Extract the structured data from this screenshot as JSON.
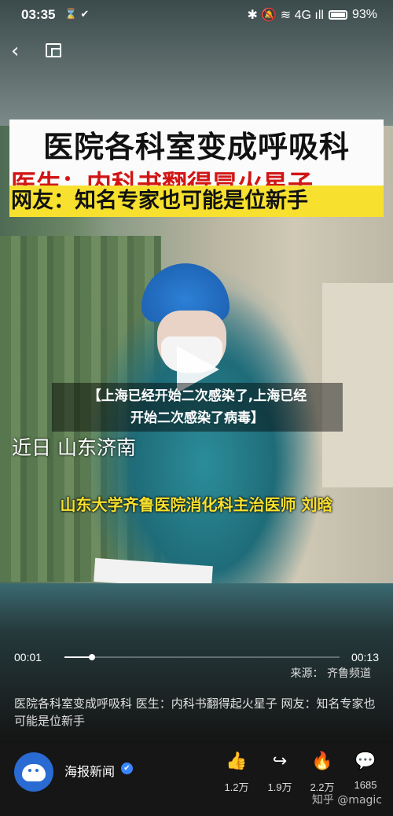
{
  "status_bar": {
    "time": "03:35",
    "left_icons": "⌛ ✔",
    "right_icons": "✱ 🔕 ≋ 4G ıll",
    "battery": "93%"
  },
  "nav": {
    "back_icon": "‹"
  },
  "video": {
    "banner_line1": "医院各科室变成呼吸科",
    "banner_line2": "医生：内科书翻得冒火星子",
    "banner_line3": "网友：知名专家也可能是位新手",
    "headline_line1": "【上海已经开始二次感染了,上海已经",
    "headline_line2": "开始二次感染了病毒】",
    "location": "近日  山东济南",
    "caption": "山东大学齐鲁医院消化科主治医师  刘晗",
    "current_time": "00:01",
    "duration": "00:13",
    "progress": 0.1,
    "source": "来源：  齐鲁频道"
  },
  "description": "医院各科室变成呼吸科 医生：内科书翻得起火星子 网友：知名专家也可能是位新手",
  "author": {
    "name": "海报新闻",
    "verified_icon": "✔"
  },
  "actions": [
    {
      "icon": "👍",
      "count": "1.2万"
    },
    {
      "icon": "↪",
      "count": "1.9万"
    },
    {
      "icon": "🔥",
      "count": "2.2万"
    },
    {
      "icon": "💬",
      "count": "1685"
    }
  ],
  "watermark": "知乎 @magic"
}
